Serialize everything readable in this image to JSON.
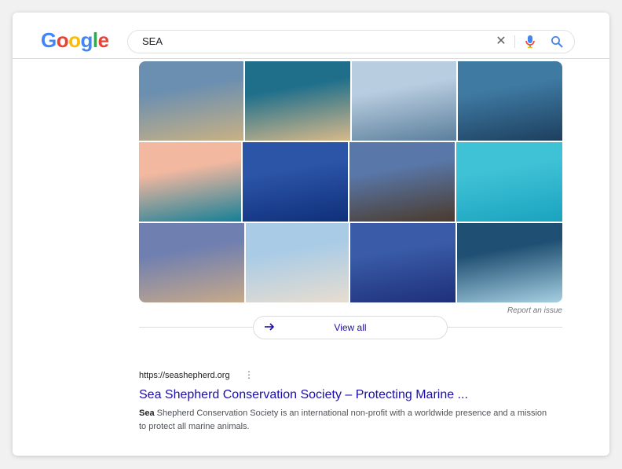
{
  "logo": {
    "letters": [
      {
        "char": "G",
        "color": "#4285F4"
      },
      {
        "char": "o",
        "color": "#EA4335"
      },
      {
        "char": "o",
        "color": "#FBBC05"
      },
      {
        "char": "g",
        "color": "#4285F4"
      },
      {
        "char": "l",
        "color": "#34A853"
      },
      {
        "char": "e",
        "color": "#EA4335"
      }
    ]
  },
  "search": {
    "value": "SEA",
    "clear_icon": "close-icon",
    "mic_icon": "microphone-icon",
    "search_icon": "search-icon"
  },
  "images": {
    "tiles": [
      {
        "name": "coastal-cliff-beach",
        "c1": "#6b8fb0",
        "c2": "#c9b184"
      },
      {
        "name": "aerial-wave-sand",
        "c1": "#1f6f8b",
        "c2": "#d8b98a"
      },
      {
        "name": "calm-sea-horizon",
        "c1": "#b9cde0",
        "c2": "#5b7f9c"
      },
      {
        "name": "dolphins-underwater",
        "c1": "#3f7aa3",
        "c2": "#1d3f5e"
      },
      {
        "name": "underwater-sun",
        "c1": "#f2b8a0",
        "c2": "#167f97"
      },
      {
        "name": "deep-blue-water",
        "c1": "#2c55a8",
        "c2": "#0f2f7a"
      },
      {
        "name": "sunset-rocky-shore",
        "c1": "#5977a8",
        "c2": "#4a3a2c"
      },
      {
        "name": "turquoise-shallows",
        "c1": "#3fc2d6",
        "c2": "#1aa3bf"
      },
      {
        "name": "beach-dusk-waves",
        "c1": "#6f7fb0",
        "c2": "#c7a98a"
      },
      {
        "name": "white-surf-shore",
        "c1": "#a9cbe6",
        "c2": "#e7ddd0"
      },
      {
        "name": "whale-tail-dusk",
        "c1": "#3a5ca8",
        "c2": "#1e2f7a"
      },
      {
        "name": "crashing-wave",
        "c1": "#1f4f72",
        "c2": "#a6cfe2"
      }
    ]
  },
  "report_issue": "Report an issue",
  "view_all": {
    "label": "View all",
    "icon": "arrow-right-icon"
  },
  "result": {
    "url": "https://seashepherd.org",
    "menu_icon": "more-vert-icon",
    "title": "Sea Shepherd Conservation Society – Protecting Marine ...",
    "snippet_bold": "Sea",
    "snippet_rest": " Shepherd Conservation Society is an international non-profit with a worldwide presence and a mission to protect all marine animals."
  },
  "colors": {
    "link": "#1a0dab",
    "accent_blue": "#4285F4",
    "border": "#dadce0"
  }
}
